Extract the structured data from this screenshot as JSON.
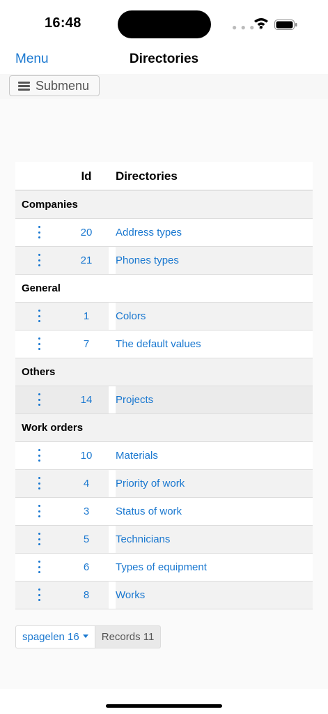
{
  "status_bar": {
    "time": "16:48",
    "icons": [
      "signal-icon",
      "wifi-icon",
      "battery-icon"
    ]
  },
  "navbar": {
    "menu_label": "Menu",
    "title": "Directories"
  },
  "toolbar": {
    "submenu_label": "Submenu",
    "submenu_icon": "hamburger-icon"
  },
  "table": {
    "headers": {
      "id": "Id",
      "directories": "Directories"
    },
    "groups": [
      {
        "label": "Companies",
        "rows": [
          {
            "id": "20",
            "name": "Address types"
          },
          {
            "id": "21",
            "name": "Phones types"
          }
        ]
      },
      {
        "label": "General",
        "rows": [
          {
            "id": "1",
            "name": "Colors"
          },
          {
            "id": "7",
            "name": "The default values"
          }
        ]
      },
      {
        "label": "Others",
        "rows": [
          {
            "id": "14",
            "name": "Projects"
          }
        ]
      },
      {
        "label": "Work orders",
        "rows": [
          {
            "id": "10",
            "name": "Materials"
          },
          {
            "id": "4",
            "name": "Priority of work"
          },
          {
            "id": "3",
            "name": "Status of work"
          },
          {
            "id": "5",
            "name": "Technicians"
          },
          {
            "id": "6",
            "name": "Types of equipment"
          },
          {
            "id": "8",
            "name": "Works"
          }
        ]
      }
    ]
  },
  "pager": {
    "page_size_label": "spagelen 16",
    "records_label": "Records 11"
  },
  "colors": {
    "accent": "#1a78d0",
    "row_alt": "#f2f2f2",
    "row_selected": "#ebebeb"
  }
}
